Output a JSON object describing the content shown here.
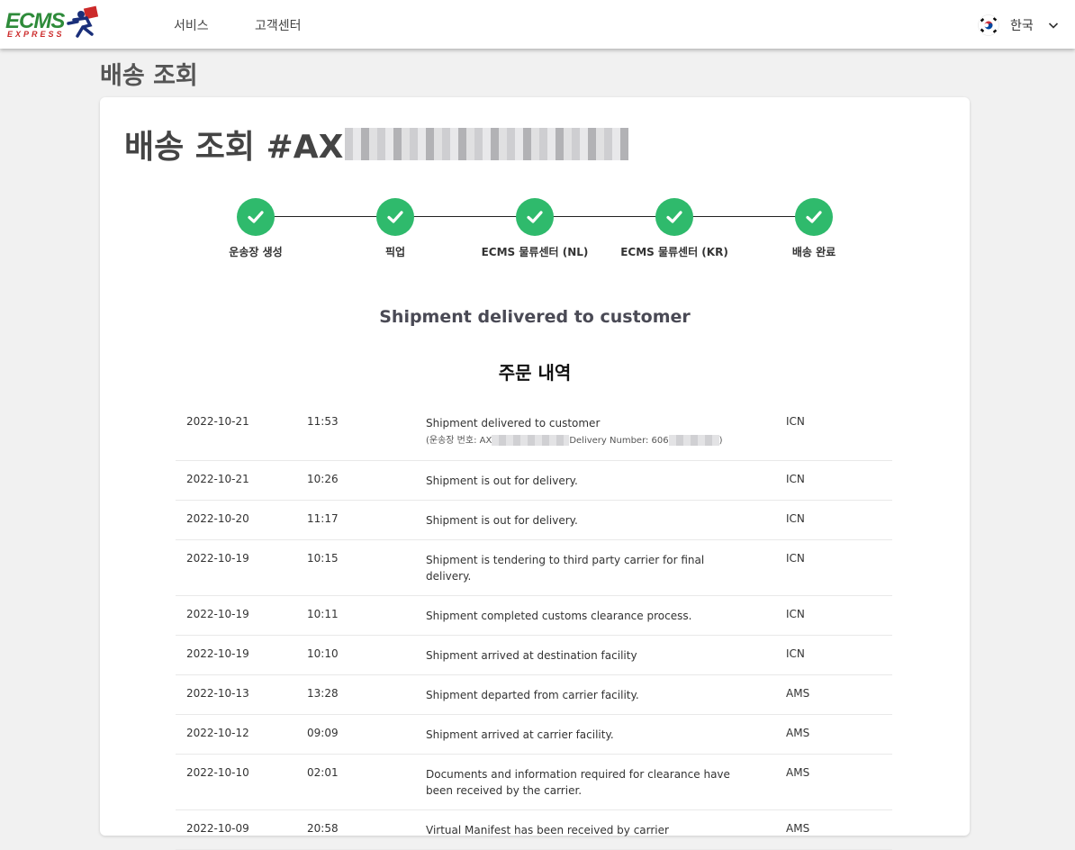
{
  "nav": {
    "logo_text": "ECMS",
    "logo_sub": "EXPRESS",
    "services": "서비스",
    "support": "고객센터",
    "language": "한국"
  },
  "page_title": "배송 조회",
  "card": {
    "title_prefix": "배송 조회 #AX",
    "steps": [
      {
        "label": "운송장 생성"
      },
      {
        "label": "픽업"
      },
      {
        "label": "ECMS 물류센터 (NL)"
      },
      {
        "label": "ECMS 물류센터 (KR)"
      },
      {
        "label": "배송 완료"
      }
    ],
    "status": "Shipment delivered to customer",
    "section_title": "주문 내역",
    "events": [
      {
        "date": "2022-10-21",
        "time": "11:53",
        "desc": "Shipment delivered to customer",
        "loc": "ICN",
        "sub_prefix": "(운송장 번호: AX",
        "sub_mid": "Delivery Number: 606",
        "sub_end": ")"
      },
      {
        "date": "2022-10-21",
        "time": "10:26",
        "desc": "Shipment is out for delivery.",
        "loc": "ICN"
      },
      {
        "date": "2022-10-20",
        "time": "11:17",
        "desc": "Shipment is out for delivery.",
        "loc": "ICN"
      },
      {
        "date": "2022-10-19",
        "time": "10:15",
        "desc": "Shipment is tendering to third party carrier for final delivery.",
        "loc": "ICN"
      },
      {
        "date": "2022-10-19",
        "time": "10:11",
        "desc": "Shipment completed customs clearance process.",
        "loc": "ICN"
      },
      {
        "date": "2022-10-19",
        "time": "10:10",
        "desc": "Shipment arrived at destination facility",
        "loc": "ICN"
      },
      {
        "date": "2022-10-13",
        "time": "13:28",
        "desc": "Shipment departed from carrier facility.",
        "loc": "AMS"
      },
      {
        "date": "2022-10-12",
        "time": "09:09",
        "desc": "Shipment arrived at carrier facility.",
        "loc": "AMS"
      },
      {
        "date": "2022-10-10",
        "time": "02:01",
        "desc": "Documents and information required for clearance have been received by the carrier.",
        "loc": "AMS"
      },
      {
        "date": "2022-10-09",
        "time": "20:58",
        "desc": "Virtual Manifest has been received by carrier",
        "loc": "AMS"
      }
    ]
  },
  "colors": {
    "check_green": "#2fba6c",
    "logo_green": "#2e8b3a",
    "logo_red": "#cc2a2a"
  }
}
